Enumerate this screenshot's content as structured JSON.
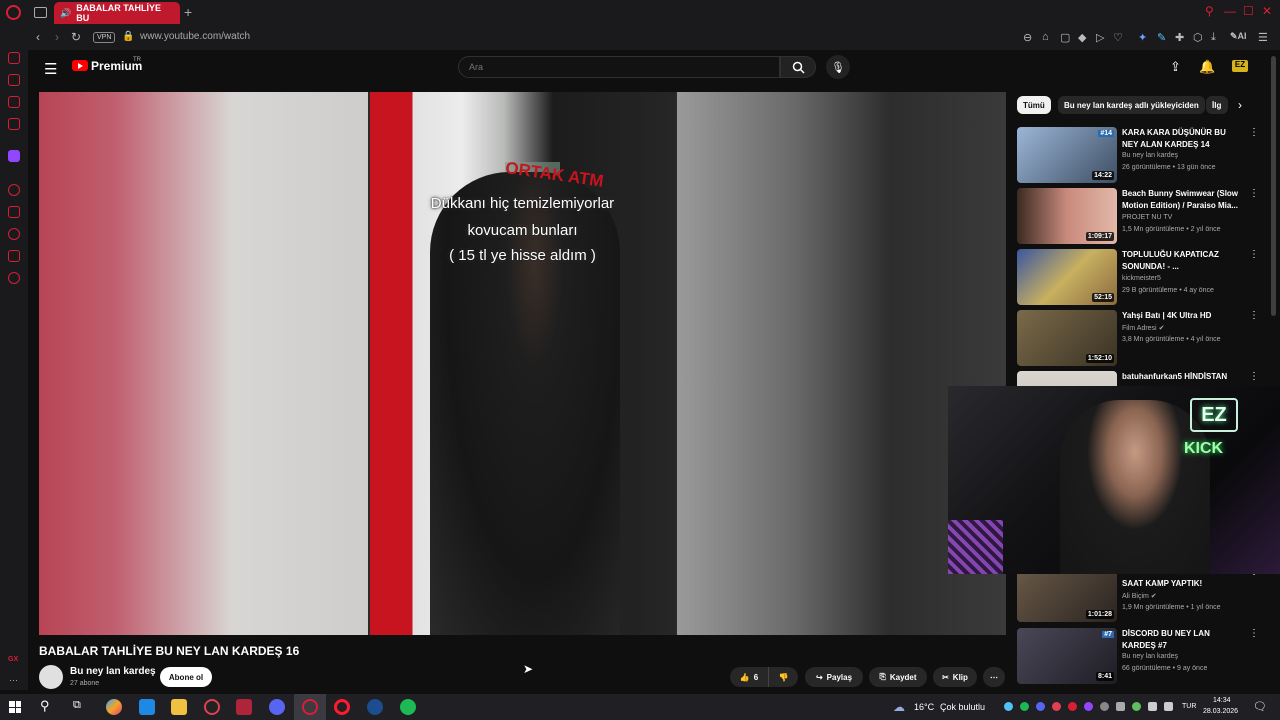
{
  "browser": {
    "tab_title": "BABALAR TAHLİYE BU",
    "new_tab": "+",
    "vpn": "VPN",
    "url": "www.youtube.com/watch",
    "ai_label": "AI"
  },
  "youtube": {
    "logo_text": "Premium",
    "logo_region": "TR",
    "search_placeholder": "Ara"
  },
  "video": {
    "captions": [
      "Dükkanı hiç temizlemiyorlar",
      "kovucam bunları",
      "( 15 tl ye hisse aldım )"
    ],
    "atm_brand": "ORTAK ATM",
    "title": "BABALAR TAHLİYE BU NEY LAN KARDEŞ 16",
    "channel": "Bu ney lan kardeş",
    "subscribers": "27 abone",
    "subscribe_label": "Abone ol",
    "likes": "6",
    "share_label": "Paylaş",
    "save_label": "Kaydet",
    "clip_label": "Klip"
  },
  "chips": [
    {
      "label": "Tümü",
      "active": true
    },
    {
      "label": "Bu ney lan kardeş adlı yükleyiciden",
      "active": false
    },
    {
      "label": "İlg",
      "active": false
    }
  ],
  "recommendations": [
    {
      "title": "KARA KARA DÜŞÜNÜR BU NEY ALAN KARDEŞ 14",
      "channel": "Bu ney lan kardeş",
      "views": "26 görüntüleme • 13 gün önce",
      "duration": "14:22",
      "badge": "#14",
      "verified": false,
      "color": "#8fa7c4"
    },
    {
      "title": "Beach Bunny Swimwear (Slow Motion Edition) / Paraiso Mia...",
      "channel": "PROJET NU TV",
      "views": "1,5 Mn görüntüleme • 2 yıl önce",
      "duration": "1:09:17",
      "badge": "",
      "verified": false,
      "color": "#c97f76"
    },
    {
      "title": "TOPLULUĞU KAPATICAZ SONUNDA! - ...",
      "channel": "kickmeister5",
      "views": "29 B görüntüleme • 4 ay önce",
      "duration": "52:15",
      "badge": "",
      "verified": false,
      "color": "#7a6a3a"
    },
    {
      "title": "Yahşi Batı | 4K Ultra HD",
      "channel": "Film Adresi",
      "views": "3,8 Mn görüntüleme • 4 yıl önce",
      "duration": "1:52:10",
      "badge": "",
      "verified": true,
      "color": "#6b5a3c"
    },
    {
      "title": "batuhanfurkan5 HİNDİSTAN",
      "channel": "",
      "views": "",
      "duration": "",
      "badge": "",
      "verified": false,
      "color": "#d7d2c8"
    },
    {
      "title": "SAAT KAMP YAPTIK!",
      "channel": "Ali Biçim",
      "views": "1,9 Mn görüntüleme • 1 yıl önce",
      "duration": "1:01:28",
      "badge": "",
      "verified": true,
      "color": "#5a4a3a"
    },
    {
      "title": "DİSCORD BU NEY LAN KARDEŞ #7",
      "channel": "Bu ney lan kardeş",
      "views": "66 görüntüleme • 9 ay önce",
      "duration": "8:41",
      "badge": "#7",
      "verified": false,
      "color": "#3b3a44"
    }
  ],
  "webcam": {
    "ez": "EZ",
    "kick": "KICK"
  },
  "taskbar": {
    "temperature": "16°C",
    "weather": "Çok bulutlu",
    "language": "TUR",
    "time": "14:34",
    "date": "28.03.2026"
  }
}
